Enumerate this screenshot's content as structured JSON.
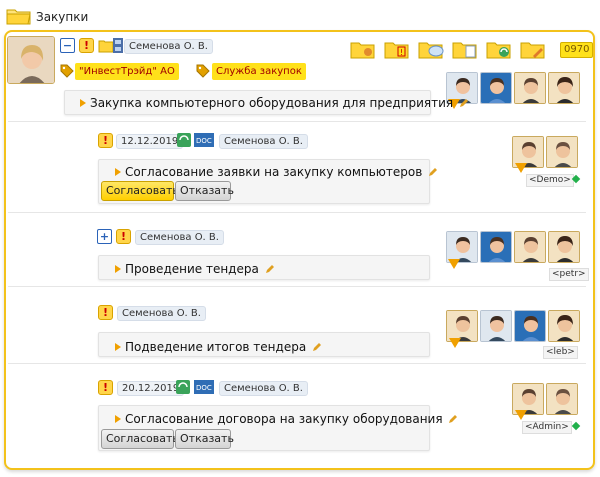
{
  "header": {
    "title": "Закупки"
  },
  "root": {
    "owner": "Семенова О. В.",
    "tags": [
      "\"ИнвестТрэйд\" АО",
      "Служба закупок"
    ],
    "title": "Закупка компьютерного оборудования для предприятия",
    "counter": "0970"
  },
  "tasks": [
    {
      "date": "12.12.2019",
      "owner": "Семенова О. В.",
      "title": "Согласование заявки на закупку компьютеров",
      "approve_label": "Согласовать",
      "reject_label": "Отказать",
      "user_label": "<Demo>"
    },
    {
      "owner": "Семенова О. В.",
      "title": "Проведение тендера",
      "user_label": "<petr>"
    },
    {
      "owner": "Семенова О. В.",
      "title": "Подведение итогов тендера",
      "user_label": "<leb>"
    },
    {
      "date": "20.12.2019",
      "owner": "Семенова О. В.",
      "title": "Согласование договора на закупку оборудования",
      "approve_label": "Согласовать",
      "reject_label": "Отказать",
      "user_label": "<Admin>"
    }
  ],
  "icons": {
    "folder": "folder-icon",
    "alert": "alert-icon",
    "refresh": "refresh-icon",
    "doc": "doc-icon",
    "edit": "pencil-icon"
  },
  "colors": {
    "accent": "#f3c21b",
    "tag": "#ffe11a",
    "status_ok": "#22b04b"
  }
}
